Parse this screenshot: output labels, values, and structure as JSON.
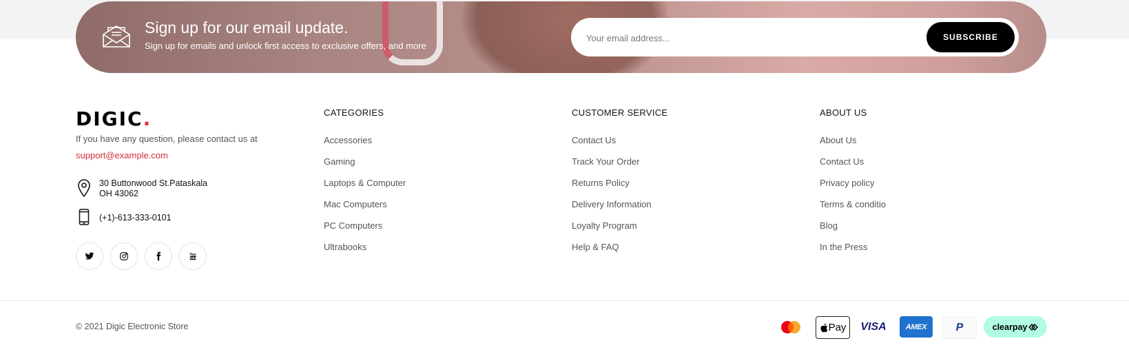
{
  "newsletter": {
    "title": "Sign up for our email update.",
    "subtitle": "Sign up for emails and unlock first access to exclusive offers, and more",
    "email_placeholder": "Your email address...",
    "subscribe_label": "SUBSCRIBE"
  },
  "brand": {
    "logo_text": "DIGIC",
    "logo_dot": ".",
    "accent_color": "#e0303f",
    "contact_text": "If you have any question, please contact us at",
    "email": "support@example.com",
    "address_line1": "30 Buttonwood St.Pataskala",
    "address_line2": "OH 43062",
    "phone": "(+1)-613-333-0101",
    "social_icons": [
      "twitter-icon",
      "instagram-icon",
      "facebook-icon",
      "youtube-icon"
    ]
  },
  "columns": {
    "categories": {
      "title": "CATEGORIES",
      "items": [
        "Accessories",
        "Gaming",
        "Laptops & Computer",
        "Mac Computers",
        "PC Computers",
        "Ultrabooks"
      ]
    },
    "customer_service": {
      "title": "CUSTOMER SERVICE",
      "items": [
        "Contact Us",
        "Track Your Order",
        "Returns Policy",
        "Delivery Information",
        "Loyalty Program",
        "Help & FAQ"
      ]
    },
    "about_us": {
      "title": "ABOUT US",
      "items": [
        "About Us",
        "Contact Us",
        "Privacy policy",
        "Terms & conditio",
        "Blog",
        "In the Press"
      ]
    }
  },
  "bottom": {
    "copyright": "© 2021 Digic Electronic Store",
    "payments": {
      "mastercard": "mastercard-icon",
      "applepay": "Pay",
      "visa": "VISA",
      "amex": "AMEX",
      "paypal": "P",
      "clearpay": "clearpay"
    }
  }
}
